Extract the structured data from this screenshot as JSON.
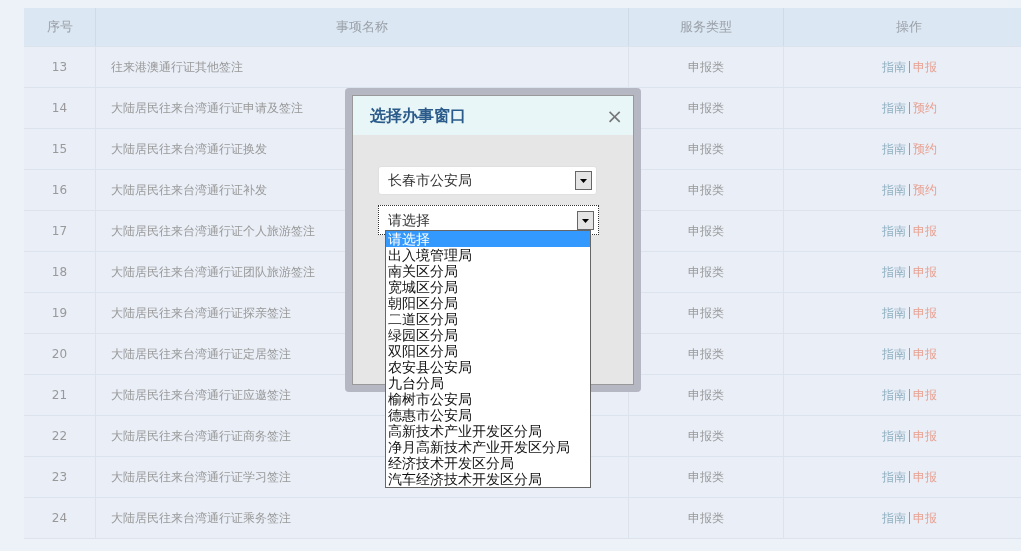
{
  "table": {
    "columns": [
      "序号",
      "事项名称",
      "服务类型",
      "操作"
    ],
    "rows": [
      {
        "seq": "13",
        "name": "往来港澳通行证其他签注",
        "type": "申报类",
        "guide": "指南",
        "action": "申报"
      },
      {
        "seq": "14",
        "name": "大陆居民往来台湾通行证申请及签注",
        "type": "申报类",
        "guide": "指南",
        "action": "预约"
      },
      {
        "seq": "15",
        "name": "大陆居民往来台湾通行证换发",
        "type": "申报类",
        "guide": "指南",
        "action": "预约"
      },
      {
        "seq": "16",
        "name": "大陆居民往来台湾通行证补发",
        "type": "申报类",
        "guide": "指南",
        "action": "预约"
      },
      {
        "seq": "17",
        "name": "大陆居民往来台湾通行证个人旅游签注",
        "type": "申报类",
        "guide": "指南",
        "action": "申报"
      },
      {
        "seq": "18",
        "name": "大陆居民往来台湾通行证团队旅游签注",
        "type": "申报类",
        "guide": "指南",
        "action": "申报"
      },
      {
        "seq": "19",
        "name": "大陆居民往来台湾通行证探亲签注",
        "type": "申报类",
        "guide": "指南",
        "action": "申报"
      },
      {
        "seq": "20",
        "name": "大陆居民往来台湾通行证定居签注",
        "type": "申报类",
        "guide": "指南",
        "action": "申报"
      },
      {
        "seq": "21",
        "name": "大陆居民往来台湾通行证应邀签注",
        "type": "申报类",
        "guide": "指南",
        "action": "申报"
      },
      {
        "seq": "22",
        "name": "大陆居民往来台湾通行证商务签注",
        "type": "申报类",
        "guide": "指南",
        "action": "申报"
      },
      {
        "seq": "23",
        "name": "大陆居民往来台湾通行证学习签注",
        "type": "申报类",
        "guide": "指南",
        "action": "申报"
      },
      {
        "seq": "24",
        "name": "大陆居民往来台湾通行证乘务签注",
        "type": "申报类",
        "guide": "指南",
        "action": "申报"
      }
    ]
  },
  "dialog": {
    "title": "选择办事窗口",
    "close": "×",
    "city_select": {
      "value": "长春市公安局"
    },
    "office_select": {
      "value": "请选择",
      "expanded": true,
      "options": [
        {
          "label": "请选择",
          "selected": true
        },
        {
          "label": "出入境管理局",
          "selected": false
        },
        {
          "label": "南关区分局",
          "selected": false
        },
        {
          "label": "宽城区分局",
          "selected": false
        },
        {
          "label": "朝阳区分局",
          "selected": false
        },
        {
          "label": "二道区分局",
          "selected": false
        },
        {
          "label": "绿园区分局",
          "selected": false
        },
        {
          "label": "双阳区分局",
          "selected": false
        },
        {
          "label": "农安县公安局",
          "selected": false
        },
        {
          "label": "九台分局",
          "selected": false
        },
        {
          "label": "榆树市公安局",
          "selected": false
        },
        {
          "label": "德惠市公安局",
          "selected": false
        },
        {
          "label": "高新技术产业开发区分局",
          "selected": false
        },
        {
          "label": "净月高新技术产业开发区分局",
          "selected": false
        },
        {
          "label": "经济技术开发区分局",
          "selected": false
        },
        {
          "label": "汽车经济技术开发区分局",
          "selected": false
        }
      ]
    }
  }
}
